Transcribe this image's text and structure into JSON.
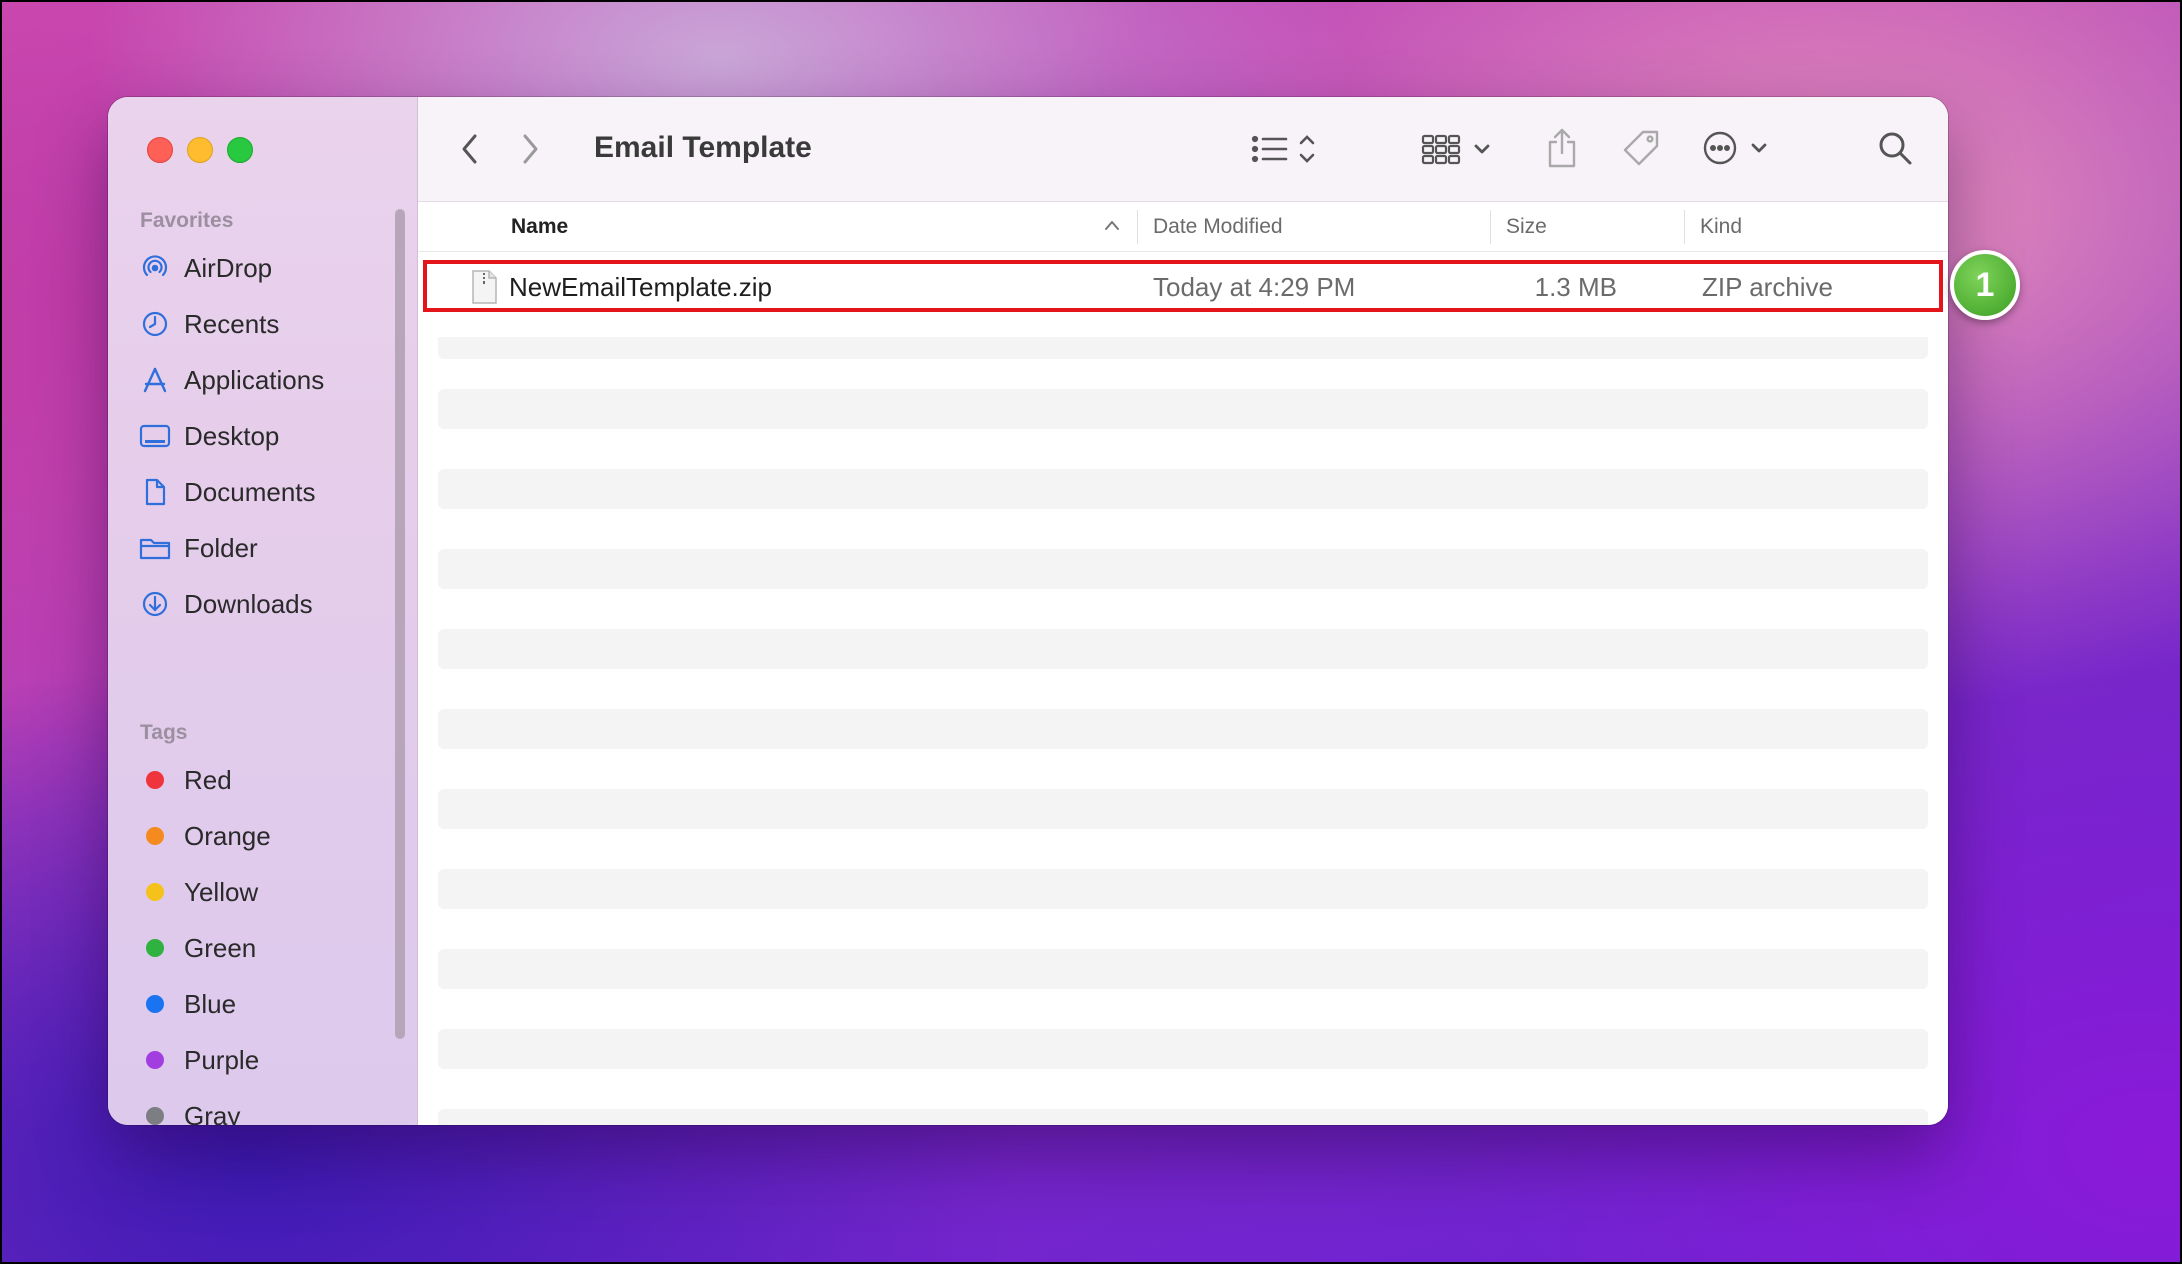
{
  "window": {
    "title": "Email Template"
  },
  "sidebar": {
    "favorites_header": "Favorites",
    "favorites": [
      {
        "label": "AirDrop",
        "icon": "airdrop-icon"
      },
      {
        "label": "Recents",
        "icon": "clock-icon"
      },
      {
        "label": "Applications",
        "icon": "applications-icon"
      },
      {
        "label": "Desktop",
        "icon": "desktop-icon"
      },
      {
        "label": "Documents",
        "icon": "document-icon"
      },
      {
        "label": "Folder",
        "icon": "folder-icon"
      },
      {
        "label": "Downloads",
        "icon": "download-icon"
      }
    ],
    "tags_header": "Tags",
    "tags": [
      {
        "label": "Red",
        "color": "#f0343c"
      },
      {
        "label": "Orange",
        "color": "#f58a1f"
      },
      {
        "label": "Yellow",
        "color": "#f4c21a"
      },
      {
        "label": "Green",
        "color": "#2fb23f"
      },
      {
        "label": "Blue",
        "color": "#1a73f0"
      },
      {
        "label": "Purple",
        "color": "#a23ee0"
      },
      {
        "label": "Gray",
        "color": "#7d7d84"
      }
    ]
  },
  "columns": {
    "name": "Name",
    "date_modified": "Date Modified",
    "size": "Size",
    "kind": "Kind"
  },
  "files": [
    {
      "name": "NewEmailTemplate.zip",
      "date_modified": "Today at 4:29 PM",
      "size": "1.3 MB",
      "kind": "ZIP archive"
    }
  ],
  "annotation": {
    "step": "1"
  },
  "colors": {
    "accent_icon": "#2f6fdc",
    "highlight": "#e3151a",
    "badge": "#4faf33"
  }
}
